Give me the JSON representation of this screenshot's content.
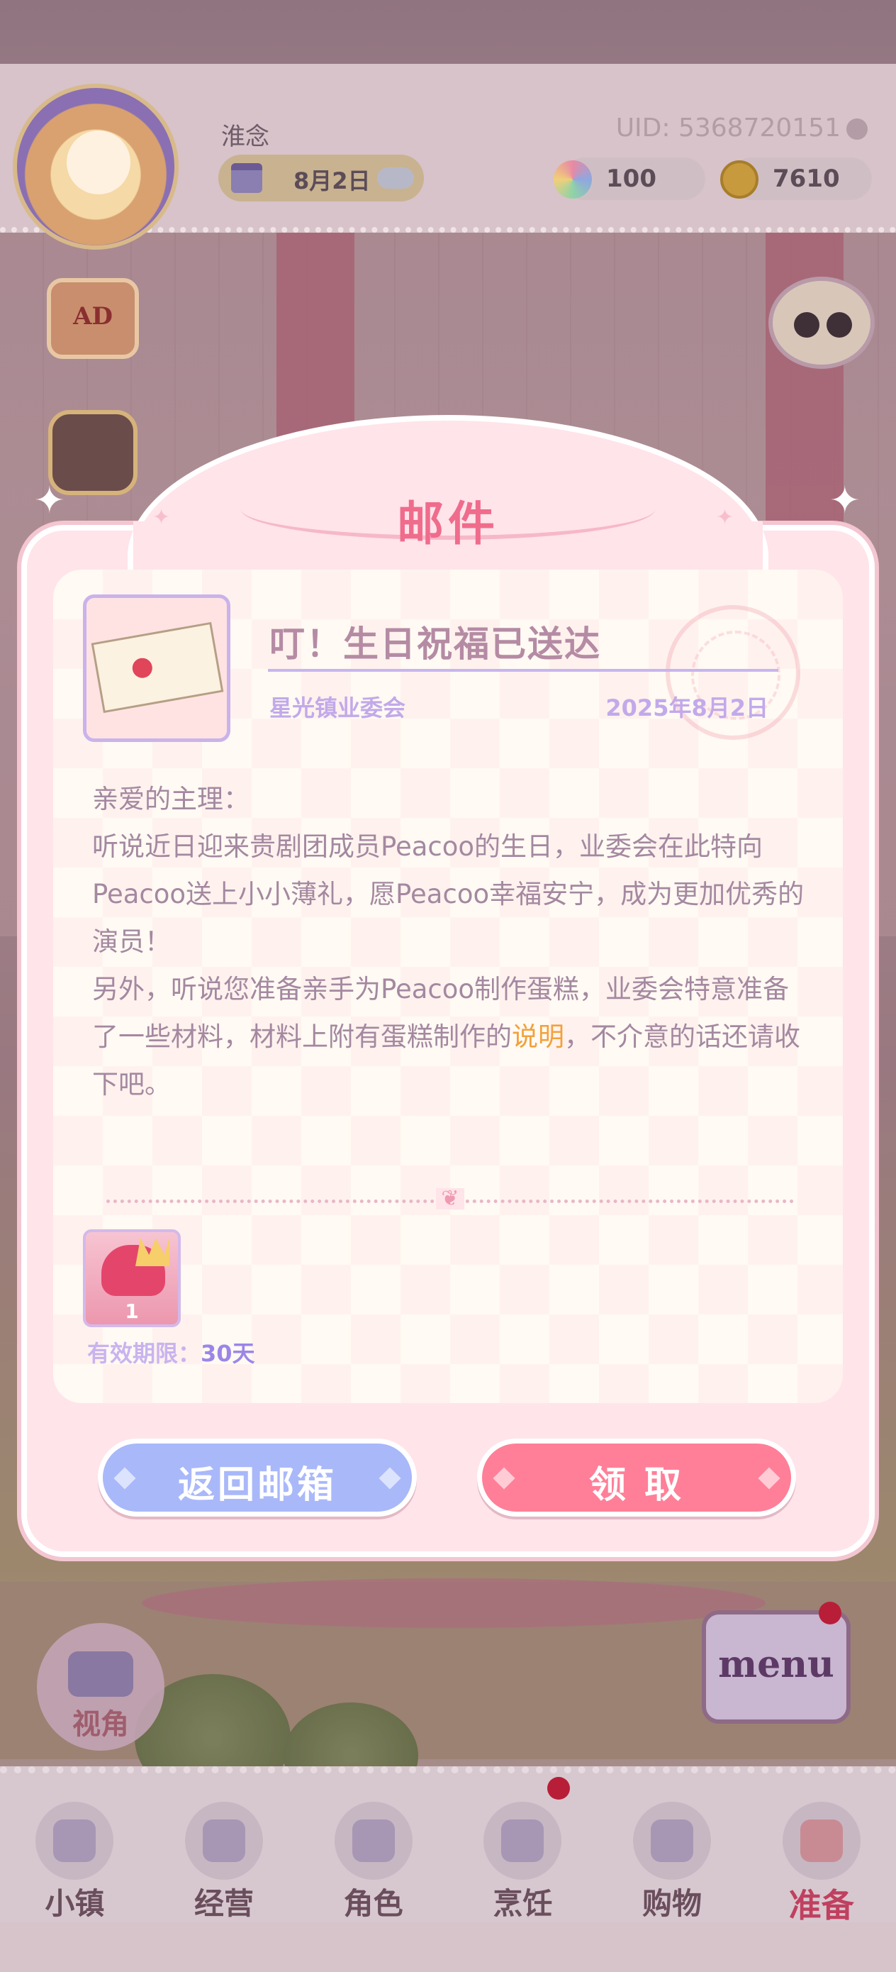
{
  "hud": {
    "player_name": "淮念",
    "date": "8月2日",
    "uid": "UID: 5368720151",
    "gems": "100",
    "coins": "7610"
  },
  "side_buttons": {
    "ad_label": "AD"
  },
  "mail": {
    "title": "邮件",
    "subject": "叮！生日祝福已送达",
    "sender": "星光镇业委会",
    "date": "2025年8月2日",
    "body_part1": "亲爱的主理：\n听说近日迎来贵剧团成员Peacoo的生日，业委会在此特向Peacoo送上小小薄礼，愿Peacoo幸福安宁，成为更加优秀的演员！\n另外，听说您准备亲手为Peacoo制作蛋糕，业委会特意准备了一些材料，材料上附有蛋糕制作的",
    "body_link": "说明",
    "body_part2": "，不介意的话还请收下吧。",
    "reward_quantity": "1",
    "expiry_label": "有效期限：",
    "expiry_value": "30天",
    "back_button": "返回邮箱",
    "claim_button": "领 取"
  },
  "scene": {
    "view_label": "视角",
    "menu_label": "menu"
  },
  "bottom_nav": {
    "items": [
      {
        "label": "小镇"
      },
      {
        "label": "经营"
      },
      {
        "label": "角色"
      },
      {
        "label": "烹饪"
      },
      {
        "label": "购物"
      },
      {
        "label": "准备"
      }
    ]
  },
  "colors": {
    "accent_pink": "#f06c8c",
    "button_blue": "#a9b8f9",
    "button_pink": "#ff7f98",
    "link_orange": "#f2a13c"
  },
  "icons": [
    "calendar-icon",
    "cloud-icon",
    "gem-icon",
    "coin-icon",
    "uid-settings-icon",
    "camera-icon",
    "letter-icon",
    "postmark-icon"
  ]
}
